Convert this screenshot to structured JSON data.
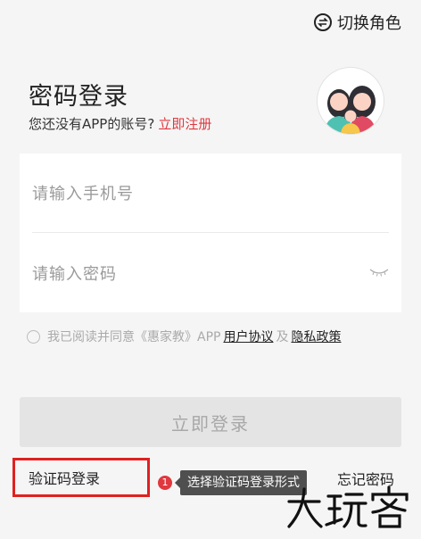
{
  "header": {
    "switch_role_label": "切换角色",
    "switch_icon": "swap-arrows-icon"
  },
  "login": {
    "title": "密码登录",
    "no_account_prompt": "您还没有APP的账号?",
    "register_link": "立即注册",
    "phone_placeholder": "请输入手机号",
    "password_placeholder": "请输入密码",
    "agreement_prefix": "我已阅读并同意《惠家教》APP",
    "user_agreement": "用户协议",
    "and": "及",
    "privacy_policy": "隐私政策",
    "login_button": "立即登录",
    "code_login": "验证码登录",
    "forgot_password": "忘记密码"
  },
  "annotation": {
    "step_number": "1",
    "tooltip": "选择验证码登录形式"
  },
  "watermark": "大玩客",
  "colors": {
    "accent": "#e0383e",
    "highlight_border": "#e02020",
    "button_disabled": "#e4e4e4"
  }
}
